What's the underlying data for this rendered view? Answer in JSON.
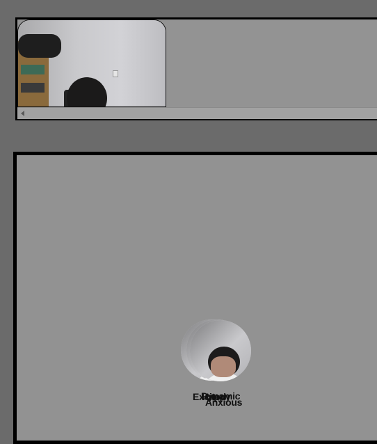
{
  "participants_strip": {
    "video_tile": {
      "description_icon": "video-feed-icon"
    }
  },
  "main_panel": {
    "emotion_labels": [
      "Excited",
      "Dynamic",
      "Happy",
      "Anxious"
    ],
    "avatar_icon": "participant-avatar-icon"
  }
}
